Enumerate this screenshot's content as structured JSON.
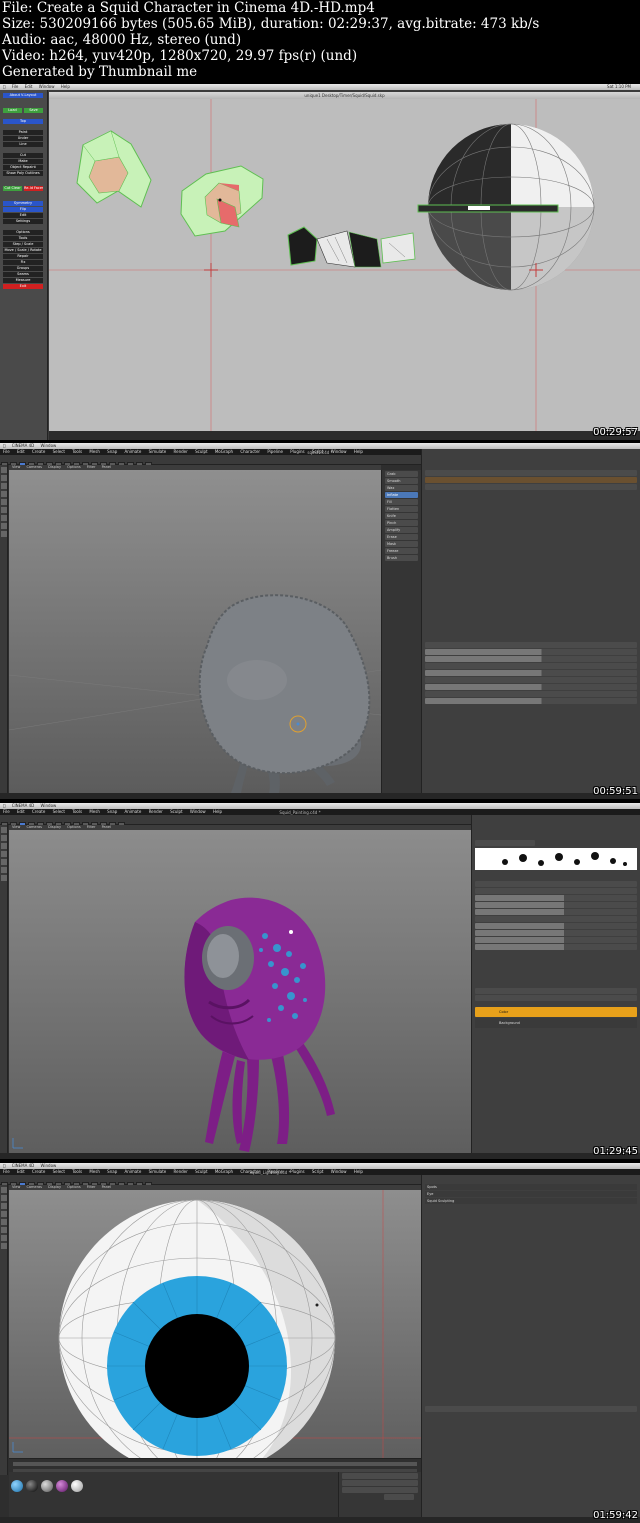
{
  "header": {
    "file": "File: Create a Squid Character in Cinema 4D.-HD.mp4",
    "size": "Size: 530209166 bytes (505.65 MiB), duration: 02:29:37, avg.bitrate: 473 kb/s",
    "audio": "Audio: aac, 48000 Hz, stereo (und)",
    "video": "Video: h264, yuv420p, 1280x720, 29.97 fps(r) (und)",
    "generated": "Generated by Thumbnail me"
  },
  "frames": [
    {
      "timestamp": "00:29:57",
      "title": "unique1 Desktop/Timer/Squid/Squid.skp"
    },
    {
      "timestamp": "00:59:51",
      "title": "squid1.c4d *"
    },
    {
      "timestamp": "01:29:45",
      "title": "Squid_Painting.c4d *"
    },
    {
      "timestamp": "01:59:42",
      "title": "Squid_Lighting.c4d *"
    }
  ],
  "app": {
    "name": "CINEMA 4D",
    "window_menu": "Window",
    "mac_menu": [
      "File",
      "Edit",
      "Window",
      "Help"
    ],
    "mac_time": "Sat 1:10 PM",
    "menu": [
      "File",
      "Edit",
      "Create",
      "Select",
      "Tools",
      "Mesh",
      "Snap",
      "Animate",
      "Simulate",
      "Render",
      "Sculpt",
      "MoGraph",
      "Character",
      "Pipeline",
      "Plugins",
      "Script",
      "Window",
      "Help"
    ],
    "viewport_menu": [
      "View",
      "Cameras",
      "Display",
      "Options",
      "Filter",
      "Panel"
    ]
  },
  "frame1_left_panel": [
    "About V-Layout",
    "Load",
    "Save",
    "Top",
    "Paint",
    "Under",
    "Line",
    "Cut",
    "Make",
    "Object Repaint",
    "Show Poly Outlines",
    "Cut Clear",
    "Re-Id Faces",
    "Symmetry",
    "Flip",
    "Edit",
    "Settings",
    "Options",
    "Tools",
    "Step / Scale",
    "Move / Scale / Rotate",
    "Repair",
    "Fix",
    "Groups",
    "Seams",
    "Measure",
    "Exit"
  ],
  "frame2_tools": [
    "Grab",
    "Smooth",
    "Wax",
    "Inflate",
    "Fill",
    "Flatten",
    "Knife",
    "Pinch",
    "Amplify",
    "Erase",
    "Mask",
    "Freeze",
    "Brush"
  ],
  "frame3_layers": [
    "Color",
    "Background"
  ],
  "frame4_objects": [
    "Spots",
    "Eye",
    "Squid Sculpting"
  ]
}
